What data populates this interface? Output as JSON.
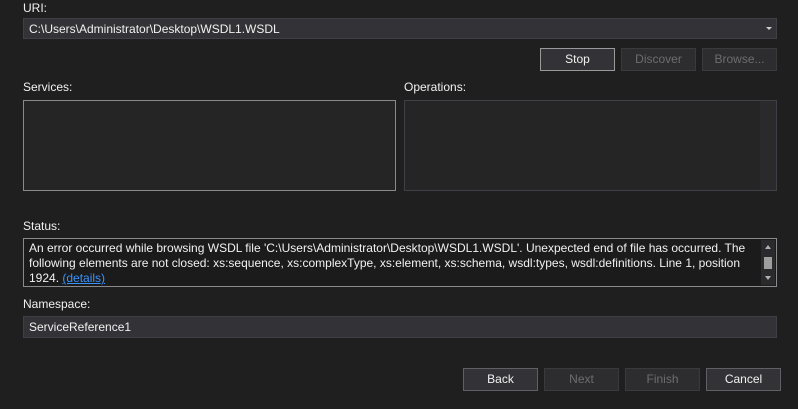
{
  "uri": {
    "label": "URI:",
    "value": "C:\\Users\\Administrator\\Desktop\\WSDL1.WSDL"
  },
  "actions": {
    "stop": "Stop",
    "discover": "Discover",
    "browse": "Browse..."
  },
  "services": {
    "label": "Services:"
  },
  "operations": {
    "label": "Operations:"
  },
  "status": {
    "label": "Status:",
    "line1": "An error occurred while browsing WSDL file 'C:\\Users\\Administrator\\Desktop\\WSDL1.WSDL'. Unexpected end of file has occurred. The",
    "line2": "following elements are not closed: xs:sequence, xs:complexType, xs:element, xs:schema, wsdl:types, wsdl:definitions. Line 1, position",
    "line3": "1924.",
    "details_link": "(details)"
  },
  "namespace": {
    "label": "Namespace:",
    "value": "ServiceReference1"
  },
  "footer": {
    "back": "Back",
    "next": "Next",
    "finish": "Finish",
    "cancel": "Cancel"
  },
  "icons": {
    "combo_arrow": "chevron-down-icon",
    "scroll_up": "scroll-up-icon",
    "scroll_down": "scroll-down-icon"
  },
  "colors": {
    "background": "#1f1f1f",
    "input_background": "#333337",
    "link": "#3794ff",
    "text": "#f1f1f1",
    "disabled_text": "#6d6d6d"
  }
}
